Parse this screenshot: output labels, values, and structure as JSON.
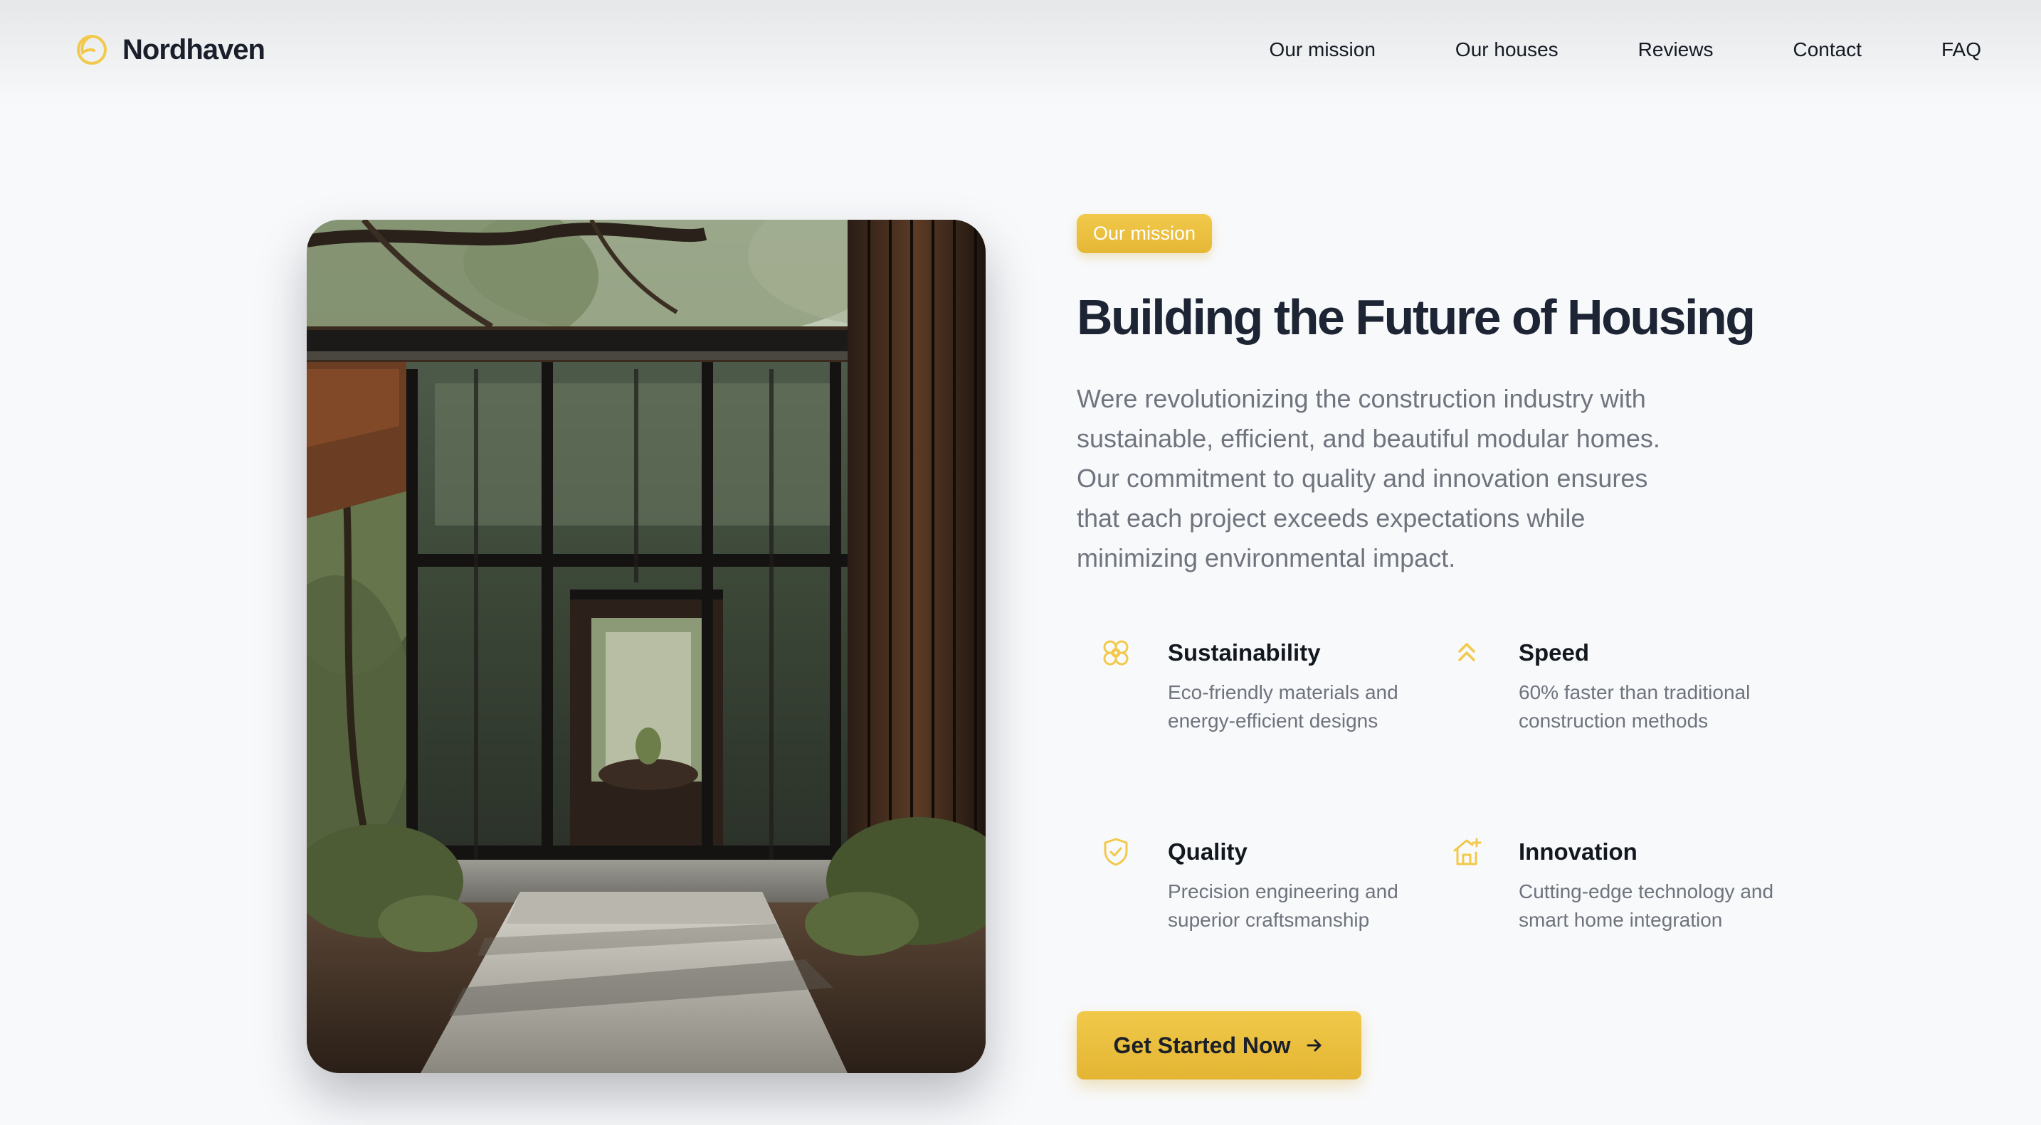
{
  "brand": {
    "name": "Nordhaven",
    "logo_icon": "crescent-logo-icon",
    "accent_color": "#f2c94b"
  },
  "nav": {
    "links": [
      {
        "label": "Our mission"
      },
      {
        "label": "Our houses"
      },
      {
        "label": "Reviews"
      },
      {
        "label": "Contact"
      },
      {
        "label": "FAQ"
      }
    ]
  },
  "hero": {
    "image_icon": "modern-glass-house-photo"
  },
  "mission": {
    "badge": "Our mission",
    "heading": "Building the Future of Housing",
    "description": "Were revolutionizing the construction industry with sustainable, efficient, and beautiful modular homes. Our commitment to quality and innovation ensures that each project exceeds expectations while minimizing environmental impact."
  },
  "features": [
    {
      "icon": "flower-icon",
      "title": "Sustainability",
      "description": "Eco-friendly materials and energy-efficient designs"
    },
    {
      "icon": "double-chevron-up-icon",
      "title": "Speed",
      "description": "60% faster than traditional construction methods"
    },
    {
      "icon": "shield-check-icon",
      "title": "Quality",
      "description": "Precision engineering and superior craftsmanship"
    },
    {
      "icon": "smart-home-icon",
      "title": "Innovation",
      "description": "Cutting-edge technology and smart home integration"
    }
  ],
  "cta": {
    "label": "Get Started Now",
    "icon": "arrow-right-icon"
  },
  "colors": {
    "accent": "#f2c94b",
    "accent_dark": "#e4b533",
    "heading": "#1d2433",
    "body_text": "#6f747e",
    "background": "#f8f9fb"
  }
}
